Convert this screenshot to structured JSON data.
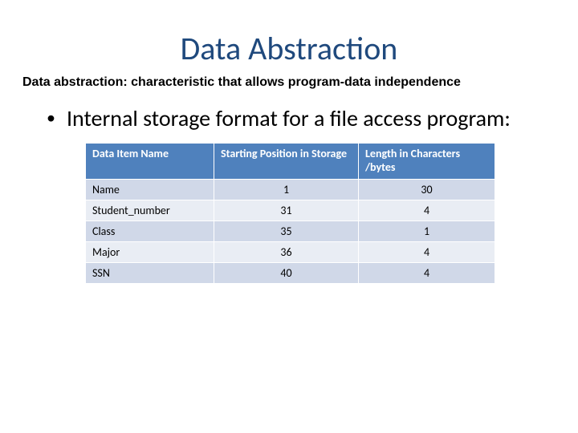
{
  "title": "Data Abstraction",
  "subtitle": "Data abstraction: characteristic that allows program-data independence",
  "bullet": "Internal storage format for a file access program:",
  "table": {
    "headers": {
      "c1": "Data Item Name",
      "c2": "Starting Position in Storage",
      "c3": "Length in Characters /bytes"
    },
    "rows": [
      {
        "name": "Name",
        "start": "1",
        "len": "30"
      },
      {
        "name": "Student_number",
        "start": "31",
        "len": "4"
      },
      {
        "name": "Class",
        "start": "35",
        "len": "1"
      },
      {
        "name": "Major",
        "start": "36",
        "len": "4"
      },
      {
        "name": "SSN",
        "start": "40",
        "len": "4"
      }
    ]
  }
}
